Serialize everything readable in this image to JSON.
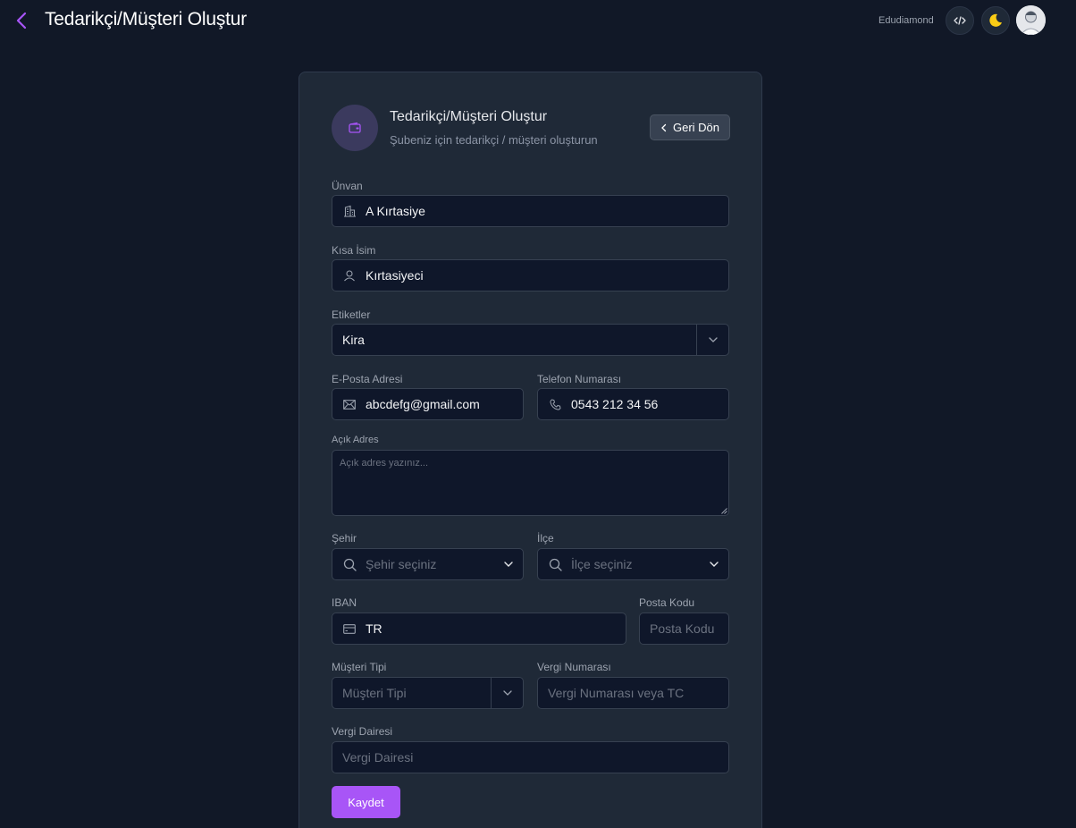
{
  "header": {
    "title": "Tedarikçi/Müşteri Oluştur",
    "brand": "Edudiamond",
    "dev_icon": "code-icon",
    "theme_icon": "moon-icon",
    "avatar_icon": "user-avatar"
  },
  "card": {
    "title": "Tedarikçi/Müşteri Oluştur",
    "subtitle": "Şubeniz için tedarikçi / müşteri oluşturun",
    "back_label": "Geri Dön",
    "header_icon": "wallet-icon"
  },
  "form": {
    "unvan": {
      "label": "Ünvan",
      "value": "A Kırtasiye",
      "icon": "building-icon"
    },
    "kisa_isim": {
      "label": "Kısa İsim",
      "value": "Kırtasiyeci",
      "icon": "user-icon"
    },
    "etiketler": {
      "label": "Etiketler",
      "value": "Kira"
    },
    "email": {
      "label": "E-Posta Adresi",
      "value": "abcdefg@gmail.com",
      "icon": "mail-icon"
    },
    "telefon": {
      "label": "Telefon Numarası",
      "value": "0543 212 34 56",
      "icon": "phone-icon"
    },
    "adres": {
      "label": "Açık Adres",
      "placeholder": "Açık adres yazınız..."
    },
    "sehir": {
      "label": "Şehir",
      "placeholder": "Şehir seçiniz",
      "icon": "search-icon"
    },
    "ilce": {
      "label": "İlçe",
      "placeholder": "İlçe seçiniz",
      "icon": "search-icon"
    },
    "iban": {
      "label": "IBAN",
      "value": "TR",
      "icon": "card-icon"
    },
    "posta_kodu": {
      "label": "Posta Kodu",
      "placeholder": "Posta Kodu"
    },
    "musteri_tipi": {
      "label": "Müşteri Tipi",
      "placeholder": "Müşteri Tipi"
    },
    "vergi_no": {
      "label": "Vergi Numarası",
      "placeholder": "Vergi Numarası veya TC"
    },
    "vergi_dairesi": {
      "label": "Vergi Dairesi",
      "placeholder": "Vergi Dairesi"
    },
    "save_label": "Kaydet"
  },
  "colors": {
    "accent": "#a855f7",
    "background": "#111827",
    "card": "#1f2937",
    "input": "#0f172a"
  }
}
